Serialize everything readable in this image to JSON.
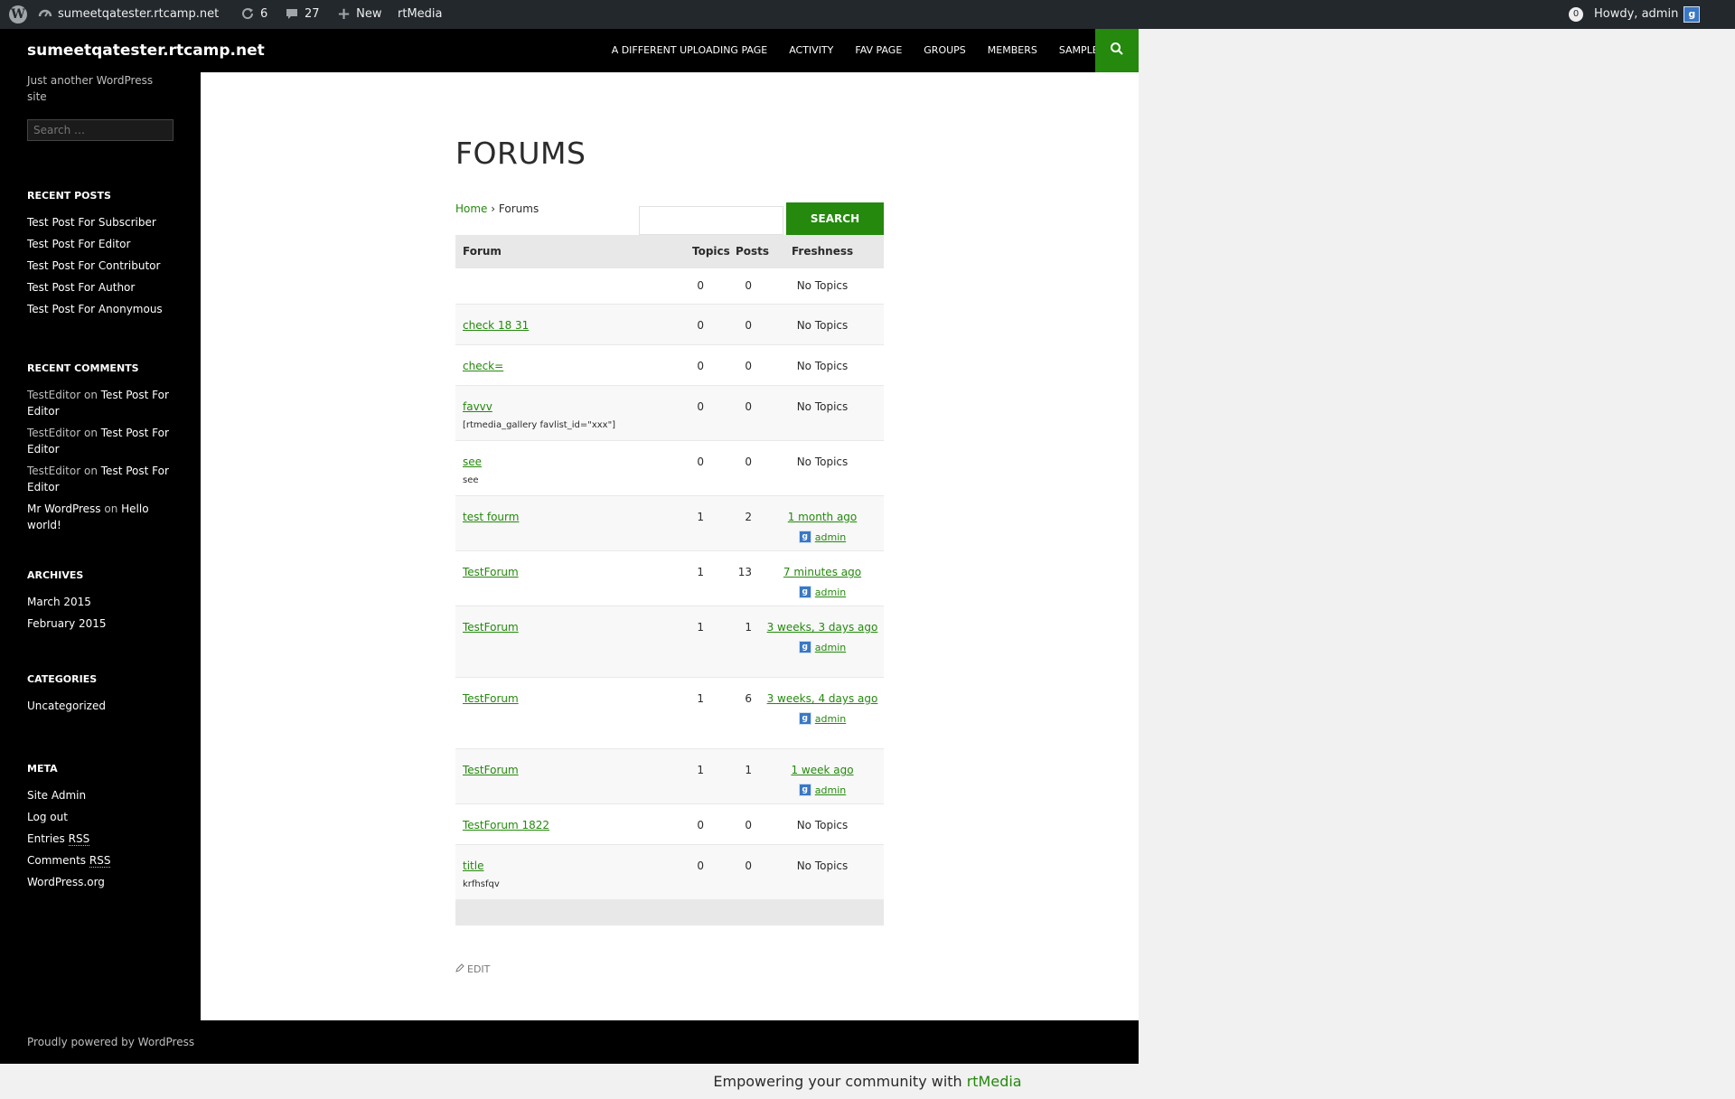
{
  "adminbar": {
    "site_name": "sumeetqatester.rtcamp.net",
    "updates_count": "6",
    "comments_count": "27",
    "new_label": "New",
    "plugin_label": "rtMedia",
    "notifications_count": "0",
    "howdy_label": "Howdy, admin"
  },
  "site": {
    "title": "sumeetqatester.rtcamp.net",
    "description": "Just another WordPress site",
    "search_placeholder": "Search …"
  },
  "nav": {
    "items": [
      "A DIFFERENT UPLOADING PAGE",
      "ACTIVITY",
      "FAV PAGE",
      "GROUPS",
      "MEMBERS",
      "SAMPLE PAGE"
    ]
  },
  "widgets": {
    "recent_posts": {
      "title": "RECENT POSTS",
      "items": [
        "Test Post For Subscriber",
        "Test Post For Editor",
        "Test Post For Contributor",
        "Test Post For Author",
        "Test Post For Anonymous"
      ]
    },
    "recent_comments": {
      "title": "RECENT COMMENTS",
      "items": [
        {
          "author": "TestEditor",
          "on": "on",
          "post": "Test Post For Editor"
        },
        {
          "author": "TestEditor",
          "on": "on",
          "post": "Test Post For Editor"
        },
        {
          "author": "TestEditor",
          "on": "on",
          "post": "Test Post For Editor"
        },
        {
          "author": "Mr WordPress",
          "on": "on",
          "post": "Hello world!"
        }
      ]
    },
    "archives": {
      "title": "ARCHIVES",
      "items": [
        "March 2015",
        "February 2015"
      ]
    },
    "categories": {
      "title": "CATEGORIES",
      "items": [
        "Uncategorized"
      ]
    },
    "meta": {
      "title": "META",
      "items": [
        "Site Admin",
        "Log out",
        "Entries",
        "Comments",
        "WordPress.org"
      ],
      "rss": "RSS"
    }
  },
  "main": {
    "page_title": "FORUMS",
    "breadcrumb": {
      "home": "Home",
      "sep": "›",
      "current": "Forums"
    },
    "search_button": "SEARCH",
    "edit_label": "EDIT"
  },
  "forum_table": {
    "headers": {
      "forum": "Forum",
      "topics": "Topics",
      "posts": "Posts",
      "freshness": "Freshness"
    },
    "rows": [
      {
        "name": "",
        "desc": "",
        "topics": "0",
        "posts": "0",
        "fresh": "No Topics",
        "author": ""
      },
      {
        "name": "check 18 31",
        "desc": "",
        "topics": "0",
        "posts": "0",
        "fresh": "No Topics",
        "author": ""
      },
      {
        "name": "check=",
        "desc": "",
        "topics": "0",
        "posts": "0",
        "fresh": "No Topics",
        "author": ""
      },
      {
        "name": "favvv",
        "desc": "[rtmedia_gallery favlist_id=\"xxx\"]",
        "topics": "0",
        "posts": "0",
        "fresh": "No Topics",
        "author": ""
      },
      {
        "name": "see",
        "desc": "see",
        "topics": "0",
        "posts": "0",
        "fresh": "No Topics",
        "author": ""
      },
      {
        "name": "test fourm",
        "desc": "",
        "topics": "1",
        "posts": "2",
        "fresh": "1 month ago",
        "author": "admin"
      },
      {
        "name": "TestForum",
        "desc": "",
        "topics": "1",
        "posts": "13",
        "fresh": "7 minutes ago",
        "author": "admin"
      },
      {
        "name": "TestForum",
        "desc": "",
        "topics": "1",
        "posts": "1",
        "fresh": "3 weeks, 3 days ago",
        "author": "admin"
      },
      {
        "name": "TestForum",
        "desc": "",
        "topics": "1",
        "posts": "6",
        "fresh": "3 weeks, 4 days ago",
        "author": "admin"
      },
      {
        "name": "TestForum",
        "desc": "",
        "topics": "1",
        "posts": "1",
        "fresh": "1 week ago",
        "author": "admin"
      },
      {
        "name": "TestForum 1822",
        "desc": "",
        "topics": "0",
        "posts": "0",
        "fresh": "No Topics",
        "author": ""
      },
      {
        "name": "title",
        "desc": "krfhsfqv",
        "topics": "0",
        "posts": "0",
        "fresh": "No Topics",
        "author": ""
      }
    ]
  },
  "footer": {
    "credit": "Proudly powered by WordPress",
    "rt_prefix": "Empowering your community with",
    "rt_brand": "rtMedia"
  },
  "colors": {
    "accent": "#24890d",
    "adminbar": "#23282d",
    "dark": "#000000"
  }
}
